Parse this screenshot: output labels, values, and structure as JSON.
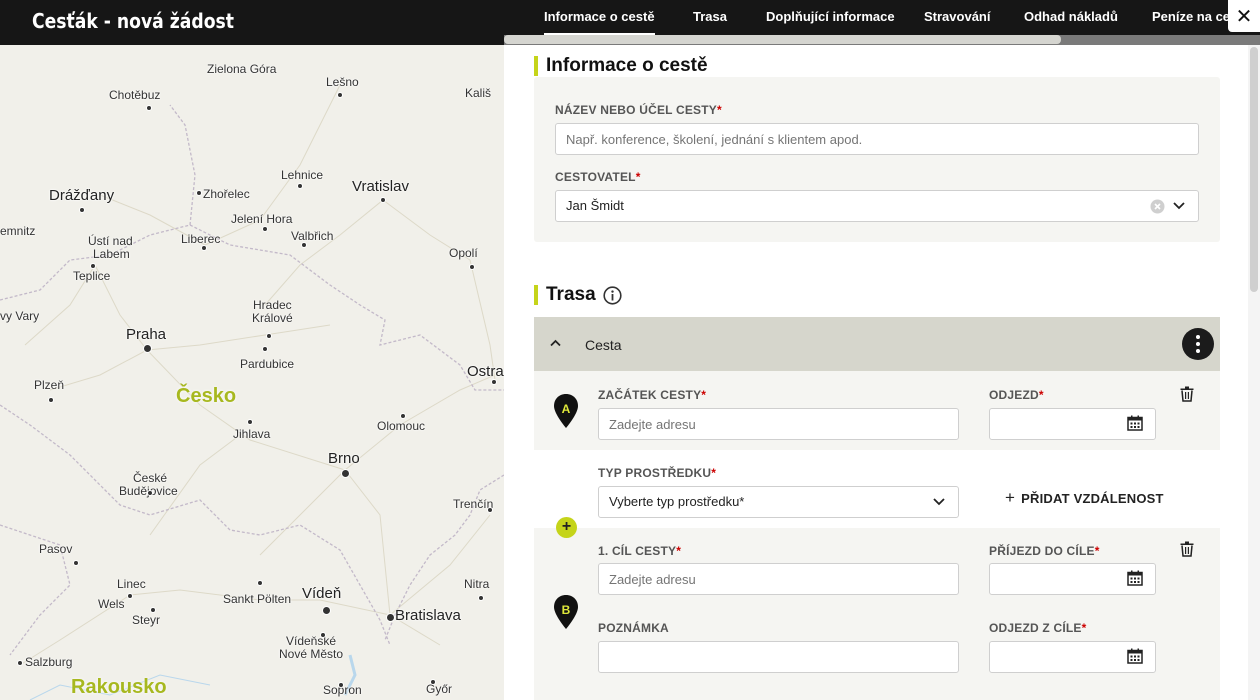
{
  "app": {
    "title": "Cesťák - nová žádost"
  },
  "tabs": [
    {
      "label": "Informace o cestě",
      "active": true
    },
    {
      "label": "Trasa",
      "active": false
    },
    {
      "label": "Doplňující informace",
      "active": false
    },
    {
      "label": "Stravování",
      "active": false
    },
    {
      "label": "Odhad nákladů",
      "active": false
    },
    {
      "label": "Peníze na cestu",
      "active": false
    }
  ],
  "map": {
    "cities": [
      "Zielona Góra",
      "Lešno",
      "Chotěbuz",
      "Kališ",
      "Lehnice",
      "Vratislav",
      "Drážďany",
      "Zhořelec",
      "Jelení Hora",
      "Valbřich",
      "emnitz",
      "Ústí nad",
      "Labem",
      "Liberec",
      "Teplice",
      "Opolí",
      "Hradec",
      "Králové",
      "vy Vary",
      "Praha",
      "Pardubice",
      "Ostra",
      "Plzeň",
      "Česko",
      "Olomouc",
      "Jihlava",
      "Brno",
      "České",
      "Budějovice",
      "Trenčín",
      "Pasov",
      "Linec",
      "Wels",
      "Sankt Pölten",
      "Vídeň",
      "Nitra",
      "Steyr",
      "Bratislava",
      "Vídeňské",
      "Nové Město",
      "Salzburg",
      "Rakousko",
      "Sopron",
      "Győr"
    ]
  },
  "trip_info": {
    "section_title": "Informace o cestě",
    "name_label": "NÁZEV NEBO ÚČEL CESTY",
    "required_mark": "*",
    "name_placeholder": "Např. konference, školení, jednání s klientem apod.",
    "traveler_label": "CESTOVATEL",
    "traveler_value": "Jan Šmidt"
  },
  "route": {
    "section_title": "Trasa",
    "header_label": "Cesta",
    "start_label": "ZAČÁTEK CESTY",
    "start_placeholder": "Zadejte adresu",
    "start_pin": "A",
    "departure_label": "ODJEZD",
    "transport_label": "TYP PROSTŘEDKU",
    "transport_value": "Vyberte typ prostředku*",
    "add_distance_label": "PŘIDAT VZDÁLENOST",
    "dest_label": "1. CÍL CESTY",
    "dest_placeholder": "Zadejte adresu",
    "dest_pin": "B",
    "arrival_label": "PŘÍJEZD DO CÍLE",
    "note_label": "POZNÁMKA",
    "leave_label": "ODJEZD Z CÍLE"
  },
  "colors": {
    "accent": "#c5d41a",
    "header_bg": "#161616",
    "card_bg": "#f5f5f2",
    "route_header_bg": "#d6d6cc",
    "country_label": "#a7b81f"
  }
}
